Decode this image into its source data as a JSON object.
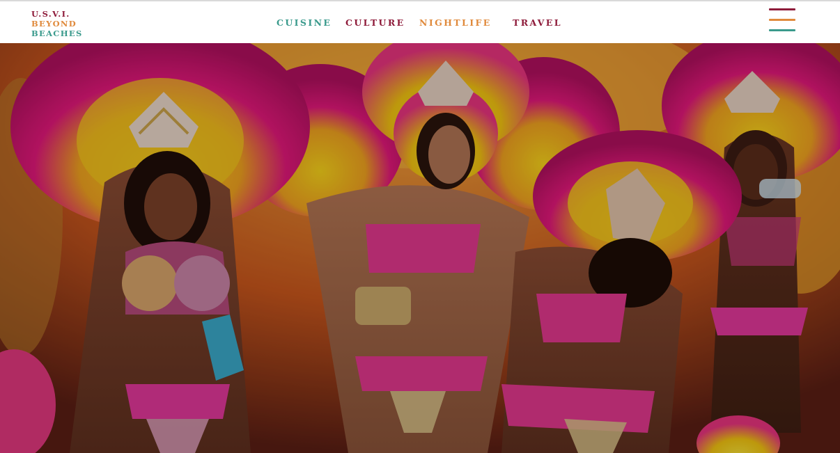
{
  "logo": {
    "line1": "U.S.V.I.",
    "line2": "BEYOND",
    "line3": "BEACHES",
    "colors": [
      "#8e1b3a",
      "#e08a3c",
      "#3a9a8c"
    ]
  },
  "nav": {
    "items": [
      {
        "label": "CUISINE",
        "color": "#3a9a8c"
      },
      {
        "label": "CULTURE",
        "color": "#8e1b3a"
      },
      {
        "label": "NIGHTLIFE",
        "color": "#e08a3c"
      },
      {
        "label": "TRAVEL",
        "color": "#8e1b3a"
      }
    ]
  },
  "menu": {
    "icon": "hamburger-menu-icon",
    "bar_colors": [
      "#8e1b3a",
      "#e08a3c",
      "#3a9a8c"
    ]
  },
  "hero": {
    "subject": "carnival-dancers-photo",
    "palette": [
      "#e0197a",
      "#f5c400",
      "#f08a00",
      "#8a4a30",
      "#e64a93"
    ]
  }
}
